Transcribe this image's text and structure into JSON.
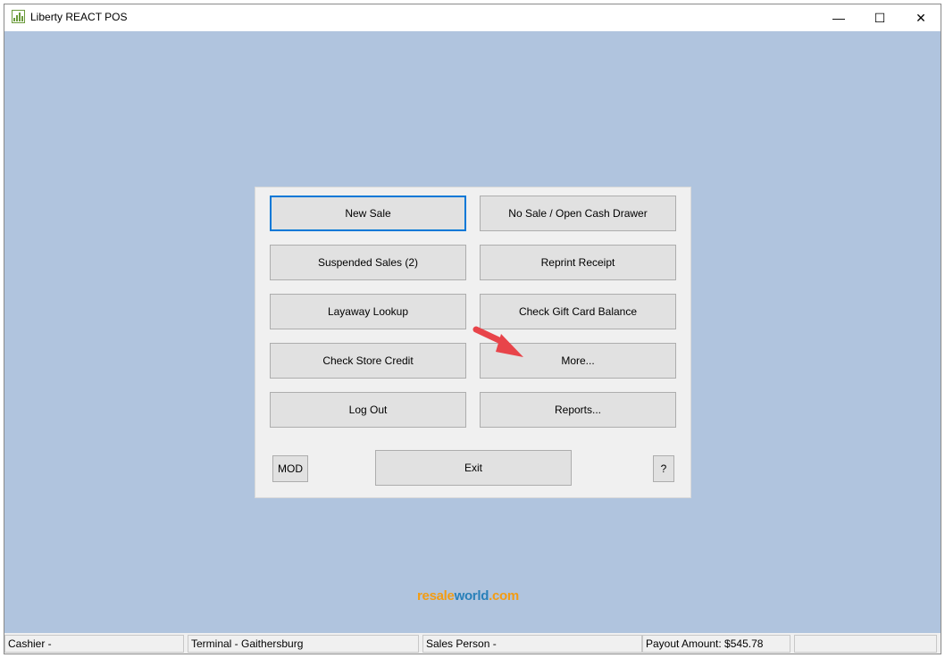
{
  "window": {
    "title": "Liberty REACT POS"
  },
  "controls": {
    "minimize": "—",
    "maximize": "☐",
    "close": "✕"
  },
  "menu": {
    "new_sale": "New Sale",
    "no_sale": "No Sale / Open Cash Drawer",
    "suspended_sales": "Suspended Sales (2)",
    "reprint_receipt": "Reprint Receipt",
    "layaway_lookup": "Layaway Lookup",
    "check_gift_card": "Check Gift Card Balance",
    "check_store_credit": "Check Store Credit",
    "more": "More...",
    "log_out": "Log Out",
    "reports": "Reports...",
    "mod": "MOD",
    "exit": "Exit",
    "help": "?"
  },
  "logo": {
    "part1": "resale",
    "part2": "world",
    "part3": ".com"
  },
  "status": {
    "cashier": "Cashier -",
    "terminal": "Terminal - Gaithersburg",
    "sales_person": "Sales Person -",
    "payout": "Payout Amount: $545.78",
    "extra": ""
  },
  "colors": {
    "background": "#b0c4de",
    "focus": "#0078d7",
    "arrow": "#e8444a"
  }
}
